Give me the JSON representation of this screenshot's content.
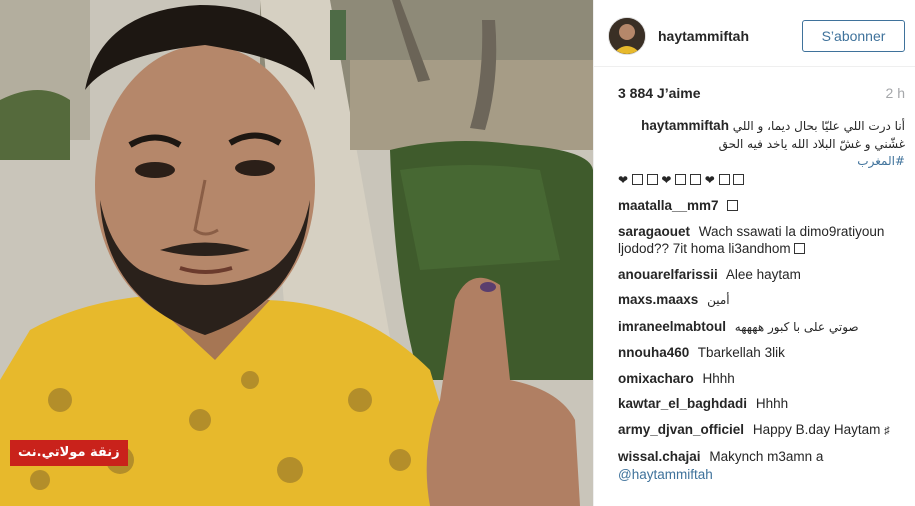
{
  "post": {
    "watermark_text": "زنقة مولاتي.نت",
    "author": {
      "username": "haytammiftah",
      "follow_label": "S’abonner"
    },
    "likes": "3 884 J’aime",
    "time_ago": "2 h",
    "caption": {
      "username": "haytammiftah",
      "text_line1": "أنا درت اللي عليّا بحال ديما، و اللي",
      "text_line2": "غشّني و غشّ البلاد الله ياخد فيه الحق",
      "hashtag": "#المغرب",
      "hearts": "❤ ❤ ❤"
    },
    "comments": [
      {
        "username": "maatalla__mm7",
        "text": ""
      },
      {
        "username": "saragaouet",
        "text": "Wach ssawati la dimo9ratiyoun ljodod?? 7it homa li3andhom"
      },
      {
        "username": "anouarelfarissii",
        "text": "Alee haytam"
      },
      {
        "username": "maxs.maaxs",
        "text": "أمين"
      },
      {
        "username": "imraneelmabtoul",
        "text": "صوتي على با كبور ههههه"
      },
      {
        "username": "nnouha460",
        "text": "Tbarkellah 3lik"
      },
      {
        "username": "omixacharo",
        "text": "Hhhh"
      },
      {
        "username": "kawtar_el_baghdadi",
        "text": "Hhhh"
      },
      {
        "username": "army_djvan_officiel",
        "text": "Happy B.day Haytam"
      },
      {
        "username": "wissal.chajai",
        "text": "Makynch m3amn a",
        "mention": "@haytammiftah"
      }
    ]
  },
  "icons": {
    "emoji": "emoji-box-icon",
    "heart": "heart-icon"
  },
  "colors": {
    "link": "#3f729b",
    "watermark_bg": "#c9221b",
    "shirt": "#e7b92c"
  }
}
